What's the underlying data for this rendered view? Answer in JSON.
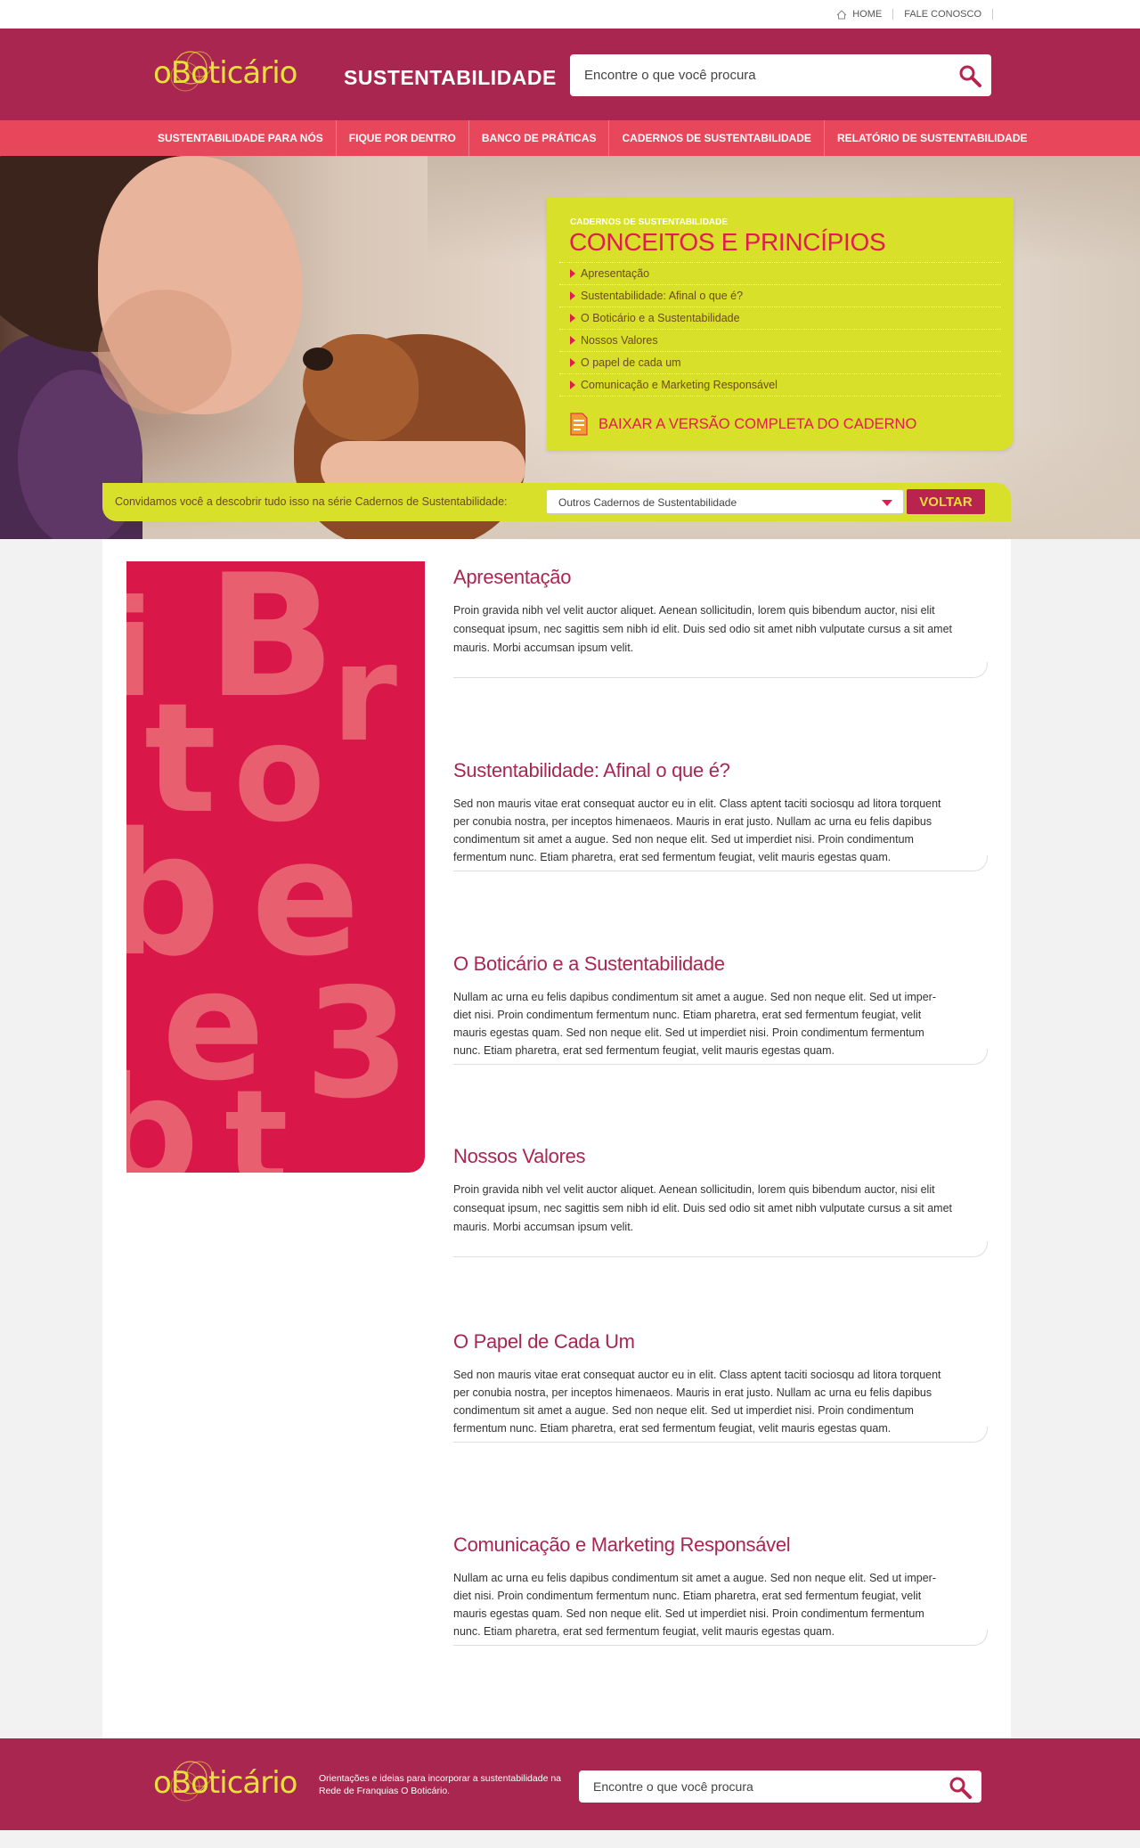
{
  "topbar": {
    "home_label": "HOME",
    "contact_label": "FALE CONOSCO"
  },
  "header": {
    "brand": "oBoticário",
    "site_title": "SUSTENTABILIDADE",
    "search_placeholder": "Encontre o que você procura"
  },
  "nav": {
    "items": [
      "SUSTENTABILIDADE PARA NÓS",
      "FIQUE POR DENTRO",
      "BANCO DE PRÁTICAS",
      "CADERNOS DE SUSTENTABILIDADE",
      "RELATÓRIO DE SUSTENTABILIDADE"
    ]
  },
  "hero": {
    "kicker": "CADERNOS DE SUSTENTABILIDADE",
    "title": "CONCEITOS E PRINCÍPIOS",
    "links": [
      "Apresentação",
      "Sustentabilidade: Afinal o que é?",
      "O Boticário e a Sustentabilidade",
      "Nossos Valores",
      "O papel  de cada um",
      "Comunicação e Marketing Responsável"
    ],
    "download_label": "BAIXAR A VERSÃO COMPLETA DO CADERNO"
  },
  "filter": {
    "label": "Convidamos você a descobrir tudo isso na série Cadernos de Sustentabilidade:",
    "select_value": "Outros Cadernos de Sustentabilidade",
    "back_label": "VOLTAR"
  },
  "sections": [
    {
      "title": "Apresentação",
      "text": "Proin gravida nibh vel velit auctor aliquet. Aenean sollicitudin, lorem quis bibendum auctor, nisi elit consequat ipsum, nec sagittis sem nibh id elit. Duis sed odio sit amet nibh vulputate cursus a sit amet mauris. Morbi accumsan ipsum velit."
    },
    {
      "title": "Sustentabilidade: Afinal o que é?",
      "text": "Sed non  mauris vitae erat consequat auctor eu in elit. Class aptent taciti sociosqu ad litora torquent per conubia nostra, per inceptos himenaeos. Mauris in erat justo. Nullam ac urna eu felis dapibus condimentum sit amet a augue. Sed non neque elit. Sed ut imperdiet nisi. Proin condimentum fermentum nunc. Etiam pharetra, erat sed fermentum feugiat, velit mauris egestas quam."
    },
    {
      "title": "O Boticário e a Sustentabilidade",
      "text": "Nullam ac urna eu felis dapibus condimentum sit amet a augue. Sed non neque elit. Sed ut imper-diet nisi. Proin condimentum fermentum nunc. Etiam pharetra, erat sed fermentum feugiat, velit mauris egestas quam. Sed non neque elit. Sed ut imperdiet nisi. Proin condimentum fermentum nunc. Etiam pharetra, erat sed fermentum feugiat, velit mauris egestas quam."
    },
    {
      "title": "Nossos Valores",
      "text": "Proin gravida nibh vel velit auctor aliquet. Aenean sollicitudin, lorem quis bibendum auctor, nisi elit consequat ipsum, nec sagittis sem nibh id elit. Duis sed odio sit amet nibh vulputate cursus a sit amet mauris. Morbi accumsan ipsum velit."
    },
    {
      "title": "O Papel de Cada Um",
      "text": "Sed non  mauris vitae erat consequat auctor eu in elit. Class aptent taciti sociosqu ad litora torquent per conubia nostra, per inceptos himenaeos. Mauris in erat justo. Nullam ac urna eu felis dapibus condimentum sit amet a augue. Sed non neque elit. Sed ut imperdiet nisi. Proin condimentum fermentum nunc. Etiam pharetra, erat sed fermentum feugiat, velit mauris egestas quam."
    },
    {
      "title": "Comunicação e Marketing Responsável",
      "text": "Nullam ac urna eu felis dapibus condimentum sit amet a augue. Sed non neque elit. Sed ut imper-diet nisi. Proin condimentum fermentum nunc. Etiam pharetra, erat sed fermentum feugiat, velit mauris egestas quam. Sed non neque elit. Sed ut imperdiet nisi. Proin condimentum fermentum nunc. Etiam pharetra, erat sed fermentum feugiat, velit mauris egestas quam."
    }
  ],
  "footer": {
    "brand": "oBoticário",
    "description": "Orientações e ideias para incorporar a sustentabilidade na Rede de Franquias O Boticário.",
    "search_placeholder": "Encontre o que você procura"
  },
  "colors": {
    "brand_wine": "#a92650",
    "nav_coral": "#e8465b",
    "lime": "#d8e02a",
    "accent_pink": "#e31b52",
    "logo_yellow": "#e8e03a"
  },
  "icons": [
    "home-icon",
    "search-icon",
    "document-icon",
    "chevron-down-icon",
    "triangle-bullet-icon"
  ]
}
